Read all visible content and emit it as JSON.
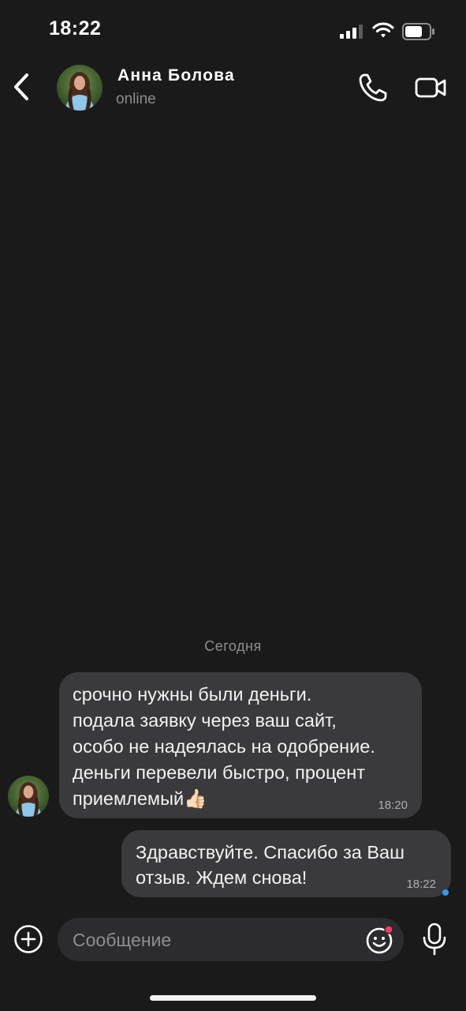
{
  "status_bar": {
    "time": "18:22"
  },
  "header": {
    "name": "Анна Болова",
    "status": "online"
  },
  "chat": {
    "date_separator": "Сегодня",
    "messages": [
      {
        "direction": "incoming",
        "text": "срочно нужны были деньги.\nподала заявку через ваш сайт,\nособо не надеялась на одобрение.\nденьги перевели быстро, процент\nприемлемый👍🏻",
        "time": "18:20"
      },
      {
        "direction": "outgoing",
        "text": "Здравствуйте. Спасибо за Ваш\nотзыв. Ждем снова!",
        "time": "18:22"
      }
    ]
  },
  "composer": {
    "placeholder": "Сообщение"
  },
  "colors": {
    "background": "#1a1a1a",
    "bubble": "#3a3a3c",
    "input": "#2c2c2e",
    "read_indicator": "#3897f0",
    "notification_dot": "#ff3b5c"
  },
  "icons": [
    "signal-icon",
    "wifi-icon",
    "battery-icon",
    "back-chevron-icon",
    "phone-icon",
    "video-icon",
    "plus-circle-icon",
    "sticker-icon",
    "microphone-icon"
  ]
}
